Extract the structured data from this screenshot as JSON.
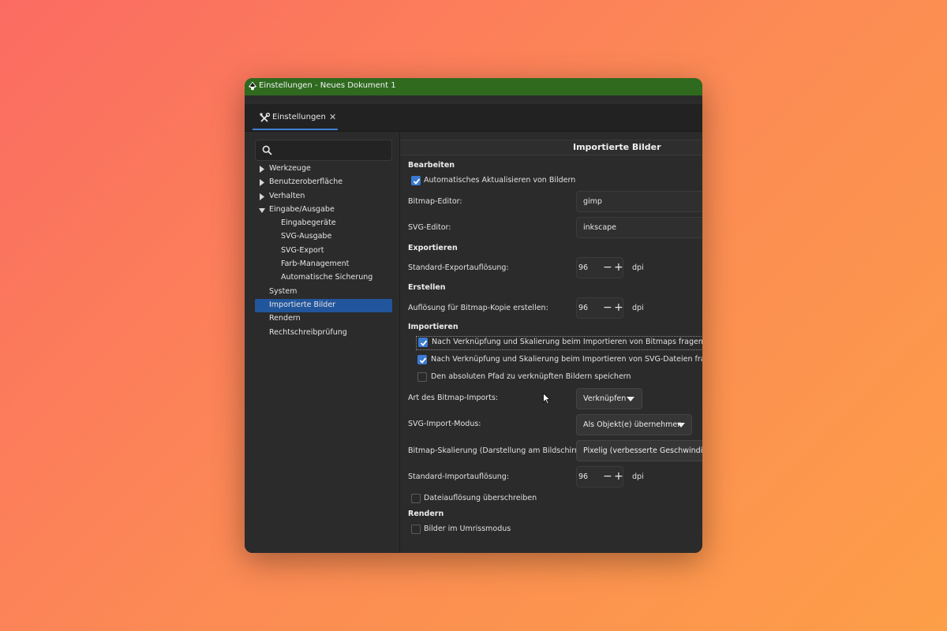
{
  "window": {
    "title": "Einstellungen - Neues Dokument 1"
  },
  "tab": {
    "label": "Einstellungen",
    "close": "✕"
  },
  "sidebar": {
    "search": {
      "placeholder": "",
      "value": ""
    },
    "items": [
      {
        "label": "Werkzeuge",
        "level": 1,
        "expander": "collapsed"
      },
      {
        "label": "Benutzeroberfläche",
        "level": 1,
        "expander": "collapsed"
      },
      {
        "label": "Verhalten",
        "level": 1,
        "expander": "collapsed"
      },
      {
        "label": "Eingabe/Ausgabe",
        "level": 1,
        "expander": "expanded"
      },
      {
        "label": "Eingabegeräte",
        "level": 2
      },
      {
        "label": "SVG-Ausgabe",
        "level": 2
      },
      {
        "label": "SVG-Export",
        "level": 2
      },
      {
        "label": "Farb-Management",
        "level": 2
      },
      {
        "label": "Automatische Sicherung",
        "level": 2
      },
      {
        "label": "System",
        "level": 1
      },
      {
        "label": "Importierte Bilder",
        "level": 1,
        "selected": true
      },
      {
        "label": "Rendern",
        "level": 1
      },
      {
        "label": "Rechtschreibprüfung",
        "level": 1
      }
    ]
  },
  "content": {
    "title": "Importierte Bilder",
    "bearbeiten": {
      "heading": "Bearbeiten",
      "auto_update": {
        "label": "Automatisches Aktualisieren von Bildern",
        "checked": true
      },
      "bitmap_editor": {
        "label": "Bitmap-Editor:",
        "value": "gimp"
      },
      "svg_editor": {
        "label": "SVG-Editor:",
        "value": "inkscape"
      }
    },
    "exportieren": {
      "heading": "Exportieren",
      "resolution": {
        "label": "Standard-Exportauflösung:",
        "value": "96",
        "unit": "dpi"
      }
    },
    "erstellen": {
      "heading": "Erstellen",
      "resolution": {
        "label": "Auflösung für Bitmap-Kopie erstellen:",
        "value": "96",
        "unit": "dpi"
      }
    },
    "importieren": {
      "heading": "Importieren",
      "ask_bitmaps": {
        "label": "Nach Verknüpfung und Skalierung beim Importieren von Bitmaps fragen",
        "checked": true
      },
      "ask_svg": {
        "label": "Nach Verknüpfung und Skalierung beim Importieren von SVG-Dateien fragen",
        "checked": true
      },
      "absolute_path": {
        "label": "Den absoluten Pfad zu verknüpften Bildern speichern",
        "checked": false
      },
      "bitmap_import_type": {
        "label": "Art des Bitmap-Imports:",
        "value": "Verknüpfen"
      },
      "svg_import_mode": {
        "label": "SVG-Import-Modus:",
        "value": "Als Objekt(e) übernehmen"
      },
      "bitmap_scaling": {
        "label": "Bitmap-Skalierung (Darstellung am Bildschirm)",
        "value": "Pixelig (verbesserte Geschwindigke"
      },
      "resolution": {
        "label": "Standard-Importauflösung:",
        "value": "96",
        "unit": "dpi"
      },
      "override_file_res": {
        "label": "Dateiauflösung überschreiben",
        "checked": false
      }
    },
    "rendern": {
      "heading": "Rendern",
      "outline_mode": {
        "label": "Bilder im Umrissmodus",
        "checked": false
      }
    }
  },
  "spin_buttons": {
    "minus": "−",
    "plus": "+"
  },
  "colors": {
    "titlebar": "#2f6a1f",
    "selection": "#22569c",
    "accent": "#3a7ad2",
    "background": "#2b2b2b"
  }
}
